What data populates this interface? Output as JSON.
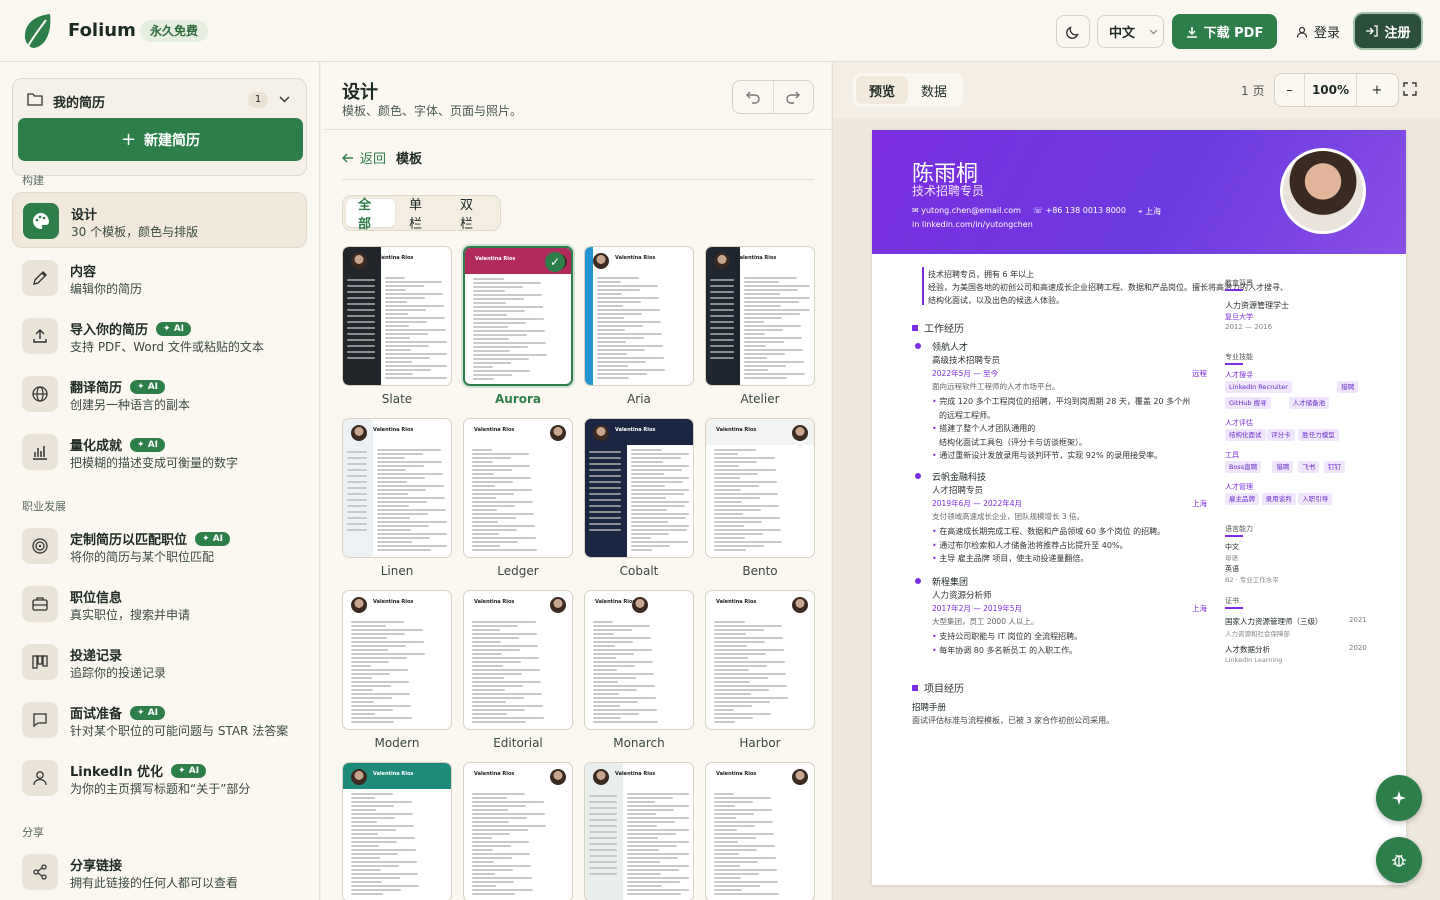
{
  "header": {
    "brand": "Folium",
    "free_badge": "永久免费",
    "language": "中文",
    "download_pdf": "下载 PDF",
    "login": "登录",
    "register": "注册"
  },
  "sidebar": {
    "my_resumes": "我的简历",
    "resume_count": "1",
    "new_resume": "新建简历",
    "sections": {
      "build": "构建",
      "career": "职业发展",
      "share": "分享"
    },
    "ai_label": "AI",
    "items": [
      {
        "title": "设计",
        "sub": "30 个模板，颜色与排版",
        "ai": false
      },
      {
        "title": "内容",
        "sub": "编辑你的简历",
        "ai": false
      },
      {
        "title": "导入你的简历",
        "sub": "支持 PDF、Word 文件或粘贴的文本",
        "ai": true
      },
      {
        "title": "翻译简历",
        "sub": "创建另一种语言的副本",
        "ai": true
      },
      {
        "title": "量化成就",
        "sub": "把模糊的描述变成可衡量的数字",
        "ai": true
      },
      {
        "title": "定制简历以匹配职位",
        "sub": "将你的简历与某个职位匹配",
        "ai": true
      },
      {
        "title": "职位信息",
        "sub": "真实职位，搜索并申请",
        "ai": false
      },
      {
        "title": "投递记录",
        "sub": "追踪你的投递记录",
        "ai": false
      },
      {
        "title": "面试准备",
        "sub": "针对某个职位的可能问题与 STAR 法答案",
        "ai": true
      },
      {
        "title": "LinkedIn 优化",
        "sub": "为你的主页撰写标题和“关于”部分",
        "ai": true
      },
      {
        "title": "分享链接",
        "sub": "拥有此链接的任何人都可以查看",
        "ai": false
      }
    ]
  },
  "design": {
    "title": "设计",
    "subtitle": "模板、颜色、字体、页面与照片。",
    "back": "返回",
    "crumb": "模板",
    "filters": [
      "全部",
      "单栏",
      "双栏"
    ],
    "mini_name": "Valentina Rios",
    "templates": [
      "Slate",
      "Aurora",
      "Aria",
      "Atelier",
      "Linen",
      "Ledger",
      "Cobalt",
      "Bento",
      "Modern",
      "Editorial",
      "Monarch",
      "Harbor"
    ]
  },
  "preview": {
    "tabs": [
      "预览",
      "数据"
    ],
    "pages": "1 页",
    "zoom": "100%",
    "accent": "#7c2ee0"
  },
  "resume": {
    "name": "陈雨桐",
    "role": "技术招聘专员",
    "email": "yutong.chen@email.com",
    "phone": "+86 138 0013 8000",
    "city": "上海",
    "linkedin": "linkedin.com/in/yutongchen",
    "summary1": "技术招聘专员，拥有 6 年以上",
    "summary2": "经验，为美国各地的初创公司和高速成长企业招聘工程、数据和产品岗位。擅长将高潜力的人才搜寻、",
    "summary3": "结构化面试，以及出色的候选人体验。",
    "work_title": "工作经历",
    "jobs": [
      {
        "company": "领航人才",
        "title": "高级技术招聘专员",
        "date": "2022年5月 — 至今",
        "loc": "远程",
        "desc": "面向远程软件工程师的人才市场平台。",
        "bullets": [
          "完成 120 多个工程岗位的招聘，平均到岗周期 28 天，覆盖 20 多个州",
          "的远程工程师。",
          "搭建了整个人才团队通用的",
          "结构化面试工具包（评分卡与访谈框架）。",
          "通过重新设计发放录用与谈判环节，实现 92% 的录用接受率。"
        ]
      },
      {
        "company": "云帆金融科技",
        "title": "人才招聘专员",
        "date": "2019年6月 — 2022年4月",
        "loc": "上海",
        "desc": "支付领域高速成长企业，团队规模增长 3 倍。",
        "bullets": [
          "在高速成长期完成工程、数据和产品领域 60 多个岗位 的招聘。",
          "通过布尔检索和人才储备池将推荐占比提升至 40%。",
          "主导 雇主品牌 项目，使主动投递量翻倍。"
        ]
      },
      {
        "company": "新程集团",
        "title": "人力资源分析师",
        "date": "2017年2月 — 2019年5月",
        "loc": "上海",
        "desc": "大型集团，员工 2000 人以上。",
        "bullets": [
          "支持公司职能与 IT 岗位的 全流程招聘。",
          "每年协调 80 多名新员工 的入职工作。"
        ]
      }
    ],
    "project_title": "项目经历",
    "project_name": "招聘手册",
    "project_desc": "面试评估标准与流程模板，已被 3 家合作初创公司采用。",
    "edu_title": "教育背景",
    "edu_degree": "人力资源管理学士",
    "edu_school": "复旦大学",
    "edu_years": "2012 — 2016",
    "skills_title": "专业技能",
    "skill_groups": [
      {
        "name": "人才搜寻",
        "tags": [
          "LinkedIn Recruiter",
          "猎聘",
          "GitHub 搜寻",
          "人才储备池"
        ]
      },
      {
        "name": "人才评估",
        "tags": [
          "结构化面试",
          "评分卡",
          "胜任力模型"
        ]
      },
      {
        "name": "工具",
        "tags": [
          "Boss直聘",
          "猎聘",
          "飞书",
          "钉钉"
        ]
      },
      {
        "name": "人才管理",
        "tags": [
          "雇主品牌",
          "录用谈判",
          "入职引导"
        ]
      }
    ],
    "lang_title": "语言能力",
    "langs": [
      {
        "name": "中文",
        "level": "母语"
      },
      {
        "name": "英语",
        "level": "B2 · 专业工作水平"
      }
    ],
    "cert_title": "证书",
    "certs": [
      {
        "name": "国家人力资源管理师（三级）",
        "org": "人力资源和社会保障部",
        "year": "2021"
      },
      {
        "name": "人才数据分析",
        "org": "LinkedIn Learning",
        "year": "2020"
      }
    ]
  }
}
